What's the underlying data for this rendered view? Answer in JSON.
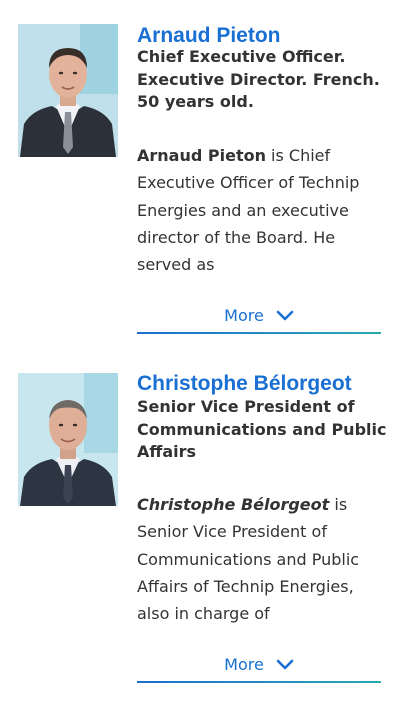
{
  "profiles": [
    {
      "name": "Arnaud Pieton",
      "role": "Chief Executive Officer. Executive Director. French. 50 years old.",
      "bio_lead": "Arnaud Pieton",
      "bio_rest": " is Chief Executive Officer of Technip Energies and an executive director of the Board. He served as",
      "more_label": "More"
    },
    {
      "name": "Christophe Bélorgeot",
      "role": "Senior Vice President of Communications and Public Affairs",
      "bio_lead": "Christophe Bélorgeot",
      "bio_rest": " is Senior Vice President of Communications and Public Affairs of Technip Energies, also in charge of",
      "more_label": "More"
    }
  ],
  "colors": {
    "accent": "#1a6fd3",
    "text": "#333333"
  },
  "icons": {
    "more": "chevron-down-icon"
  }
}
